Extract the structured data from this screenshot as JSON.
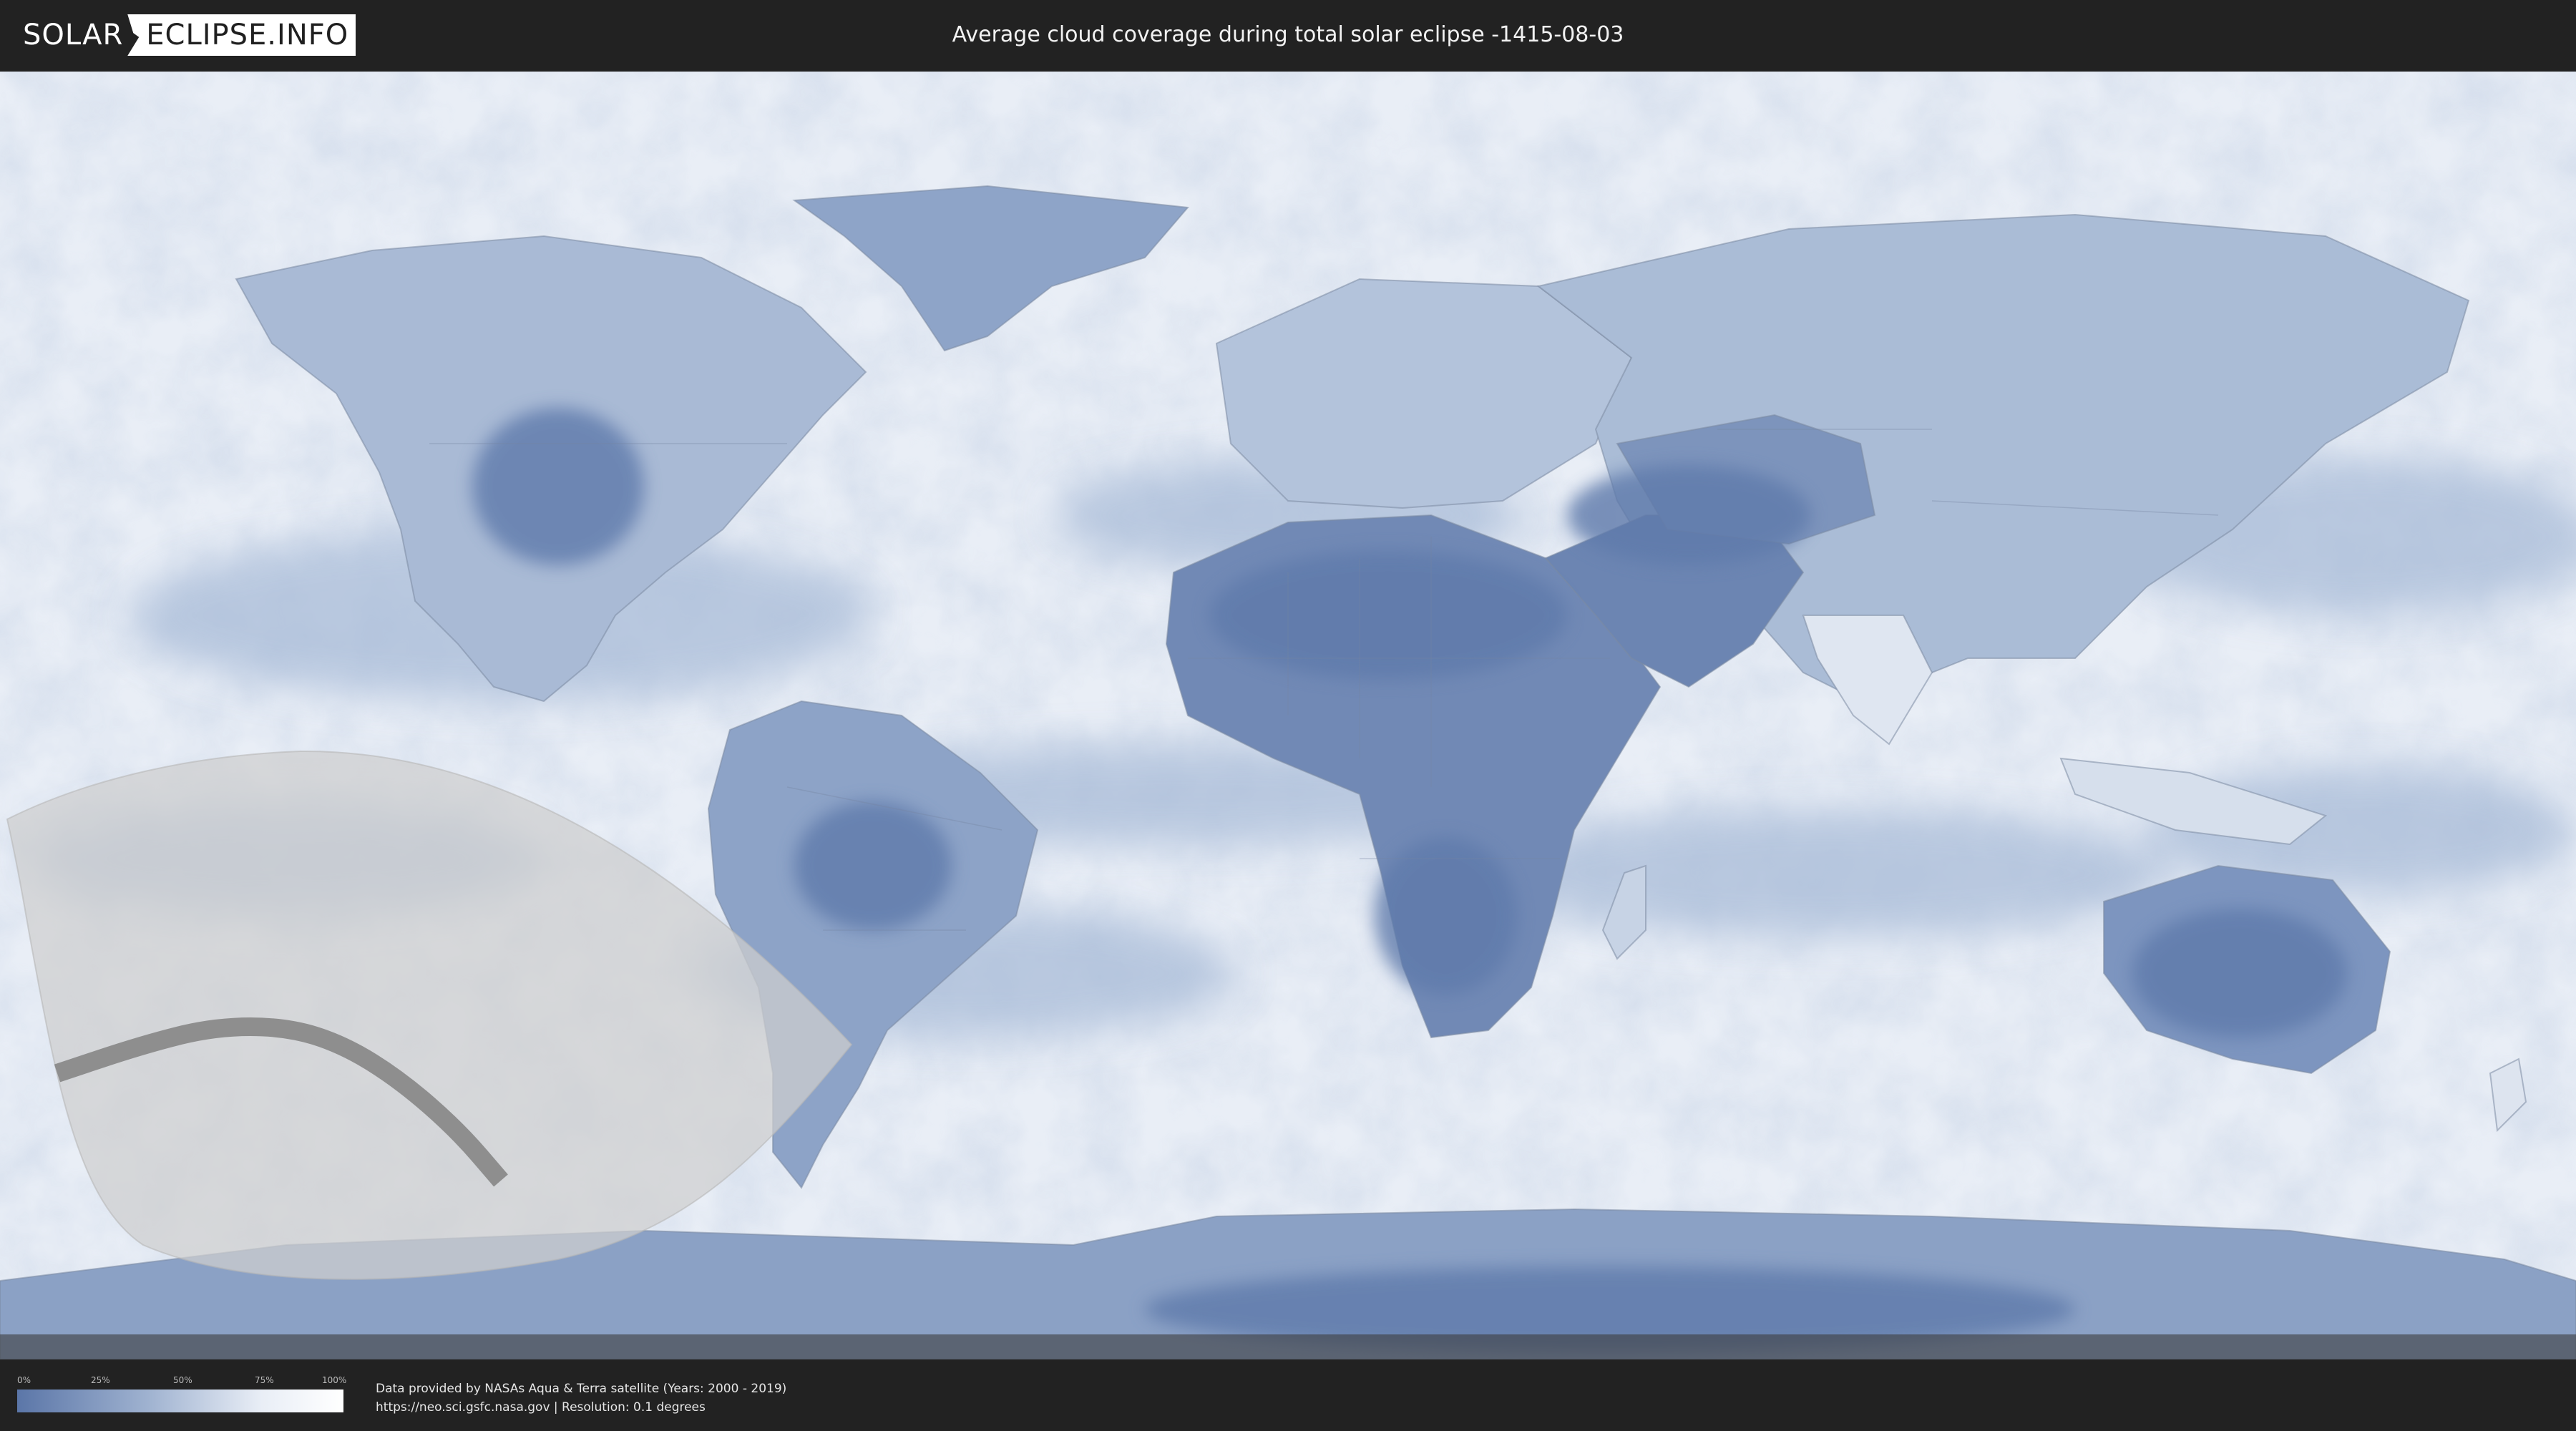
{
  "header": {
    "logo_left": "SOLAR",
    "logo_right": "ECLIPSE.INFO",
    "title": "Average cloud coverage during total solar eclipse -1415-08-03"
  },
  "legend": {
    "ticks": [
      "0%",
      "25%",
      "50%",
      "75%",
      "100%"
    ],
    "tick_values": [
      0,
      25,
      50,
      75,
      100
    ],
    "color_low": "#5b76a8",
    "color_high": "#ffffff"
  },
  "footer": {
    "credit_line1": "Data provided by NASAs Aqua & Terra satellite (Years: 2000 - 2019)",
    "credit_line2": "https://neo.sci.gsfc.nasa.gov | Resolution: 0.1 degrees"
  },
  "map": {
    "projection": "equirectangular",
    "ocean_cloud_color": "#eef2f8",
    "dry_region_color": "#6781ad",
    "eclipse_zone_color": "#d6d6d6",
    "eclipse_path_color": "#8a8a8a",
    "eclipse_path_lonlat": [
      [
        -172,
        -50
      ],
      [
        -160,
        -46
      ],
      [
        -150,
        -43.5
      ],
      [
        -140,
        -43.5
      ],
      [
        -132,
        -46
      ],
      [
        -124,
        -51
      ],
      [
        -116,
        -58
      ],
      [
        -110,
        -65
      ]
    ]
  }
}
